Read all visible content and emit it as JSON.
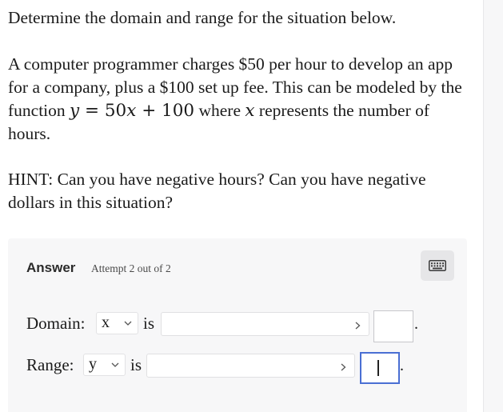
{
  "question": {
    "line1": "Determine the domain and range for the situation below.",
    "para2_part1": "A computer programmer charges $50 per hour to develop an app for a company, plus a $100 set up fee. This can be modeled by the function ",
    "func_var": "y",
    "func_eq": " = 50",
    "func_x": "x",
    "func_rest": " + 100",
    "para2_part2": " where ",
    "where_x": "x",
    "para2_part3": " represents the number of hours.",
    "hint": "HINT: Can you have negative hours? Can you have negative dollars in this situation?"
  },
  "answer": {
    "label": "Answer",
    "attempt": "Attempt 2 out of 2",
    "keyboard_icon": "keyboard-icon",
    "domain": {
      "label": "Domain:",
      "variable": "x",
      "is_text": "is",
      "interval_value": "",
      "number_value": "",
      "period": "."
    },
    "range": {
      "label": "Range:",
      "variable": "y",
      "is_text": "is",
      "interval_value": "",
      "number_value": "",
      "period": "."
    }
  },
  "colors": {
    "panel_bg": "#f7f7f8",
    "focus_border": "#4a6fd3"
  }
}
